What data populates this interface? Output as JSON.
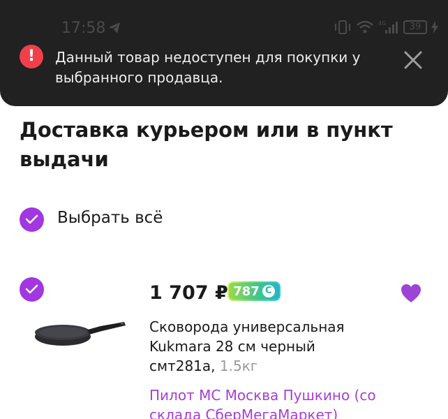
{
  "status_bar": {
    "time": "17:58",
    "battery": "39",
    "network": "4G"
  },
  "snackbar": {
    "message": "Данный товар недоступен для покупки у выбранного продавца.",
    "error_icon": "!",
    "accent": "#f2404a"
  },
  "delivery": {
    "title": "Доставка курьером или в пункт выдачи",
    "select_all_label": "Выбрать всё"
  },
  "product": {
    "price": "1 707 ₽",
    "bonus": "787",
    "bonus_icon": "С",
    "name": "Сковорода универсальная Kukmara 28 см черный смт281а,",
    "weight": "1.5кг",
    "seller": "Пилот МС Москва Пушкино (со склада СберМегаМаркет)"
  },
  "colors": {
    "accent": "#a236e0",
    "seller_link": "#a63ed6",
    "snackbar_bg": "#212121"
  }
}
